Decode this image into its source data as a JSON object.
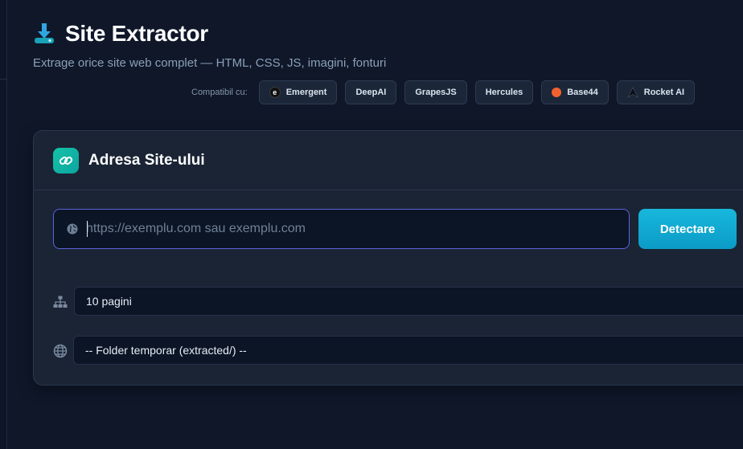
{
  "app": {
    "title": "Site Extractor",
    "subtitle": "Extrage orice site web complet — HTML, CSS, JS, imagini, fonturi",
    "logo_icon": "download-drive-icon",
    "accent": "#14c2a8"
  },
  "compat": {
    "label": "Compatibil cu:",
    "items": [
      {
        "label": "Emergent",
        "icon": "emergent-logo-icon"
      },
      {
        "label": "DeepAI"
      },
      {
        "label": "GrapesJS"
      },
      {
        "label": "Hercules"
      },
      {
        "label": "Base44",
        "icon": "base44-logo-icon",
        "color": "#f2622e"
      },
      {
        "label": "Rocket AI",
        "icon": "rocket-ai-logo-icon"
      }
    ]
  },
  "card": {
    "title": "Adresa Site-ului",
    "icon": "link-icon",
    "url": {
      "value": "",
      "placeholder": "https://exemplu.com sau exemplu.com",
      "icon": "globe-icon"
    },
    "detect_label": "Detectare",
    "pages_value": "10 pagini",
    "pages_icon": "sitemap-icon",
    "folder_value": "-- Folder temporar (extracted/) --",
    "folder_icon": "globe-icon"
  }
}
